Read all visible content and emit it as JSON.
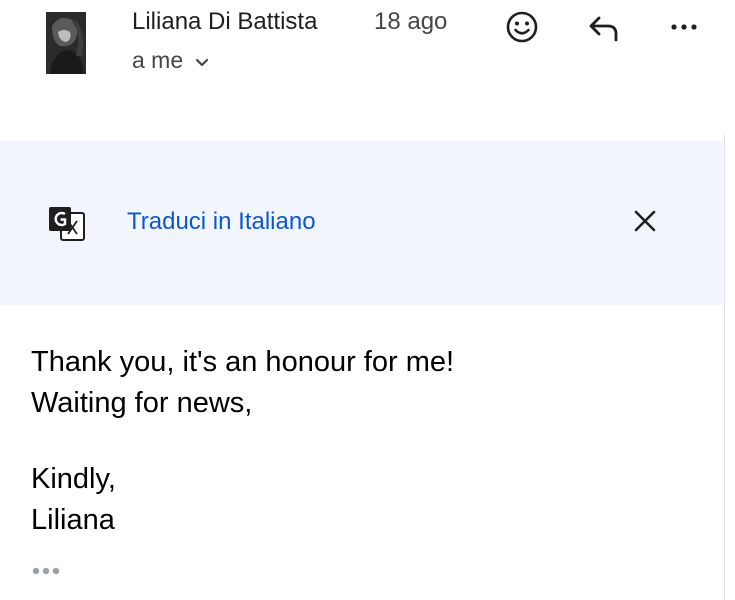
{
  "message": {
    "sender": "Liliana Di Battista",
    "date": "18 ago",
    "recipients": "a me",
    "body_lines": [
      "Thank you, it's an honour for me!",
      "Waiting for news,",
      "Kindly,",
      "Liliana"
    ]
  },
  "translate_banner": {
    "link_label": "Traduci in Italiano"
  },
  "icons": {
    "emoji": "smiley-face-icon",
    "reply": "reply-arrow-icon",
    "more": "more-vert-icon",
    "translate": "google-translate-icon",
    "close": "close-icon",
    "expand": "chevron-down-icon",
    "trimmed": "ellipsis-icon"
  },
  "colors": {
    "accent_link": "#0b57d0",
    "banner_bg": "#f2f6fc",
    "text": "#1f1f1f",
    "secondary_text": "#444746"
  }
}
